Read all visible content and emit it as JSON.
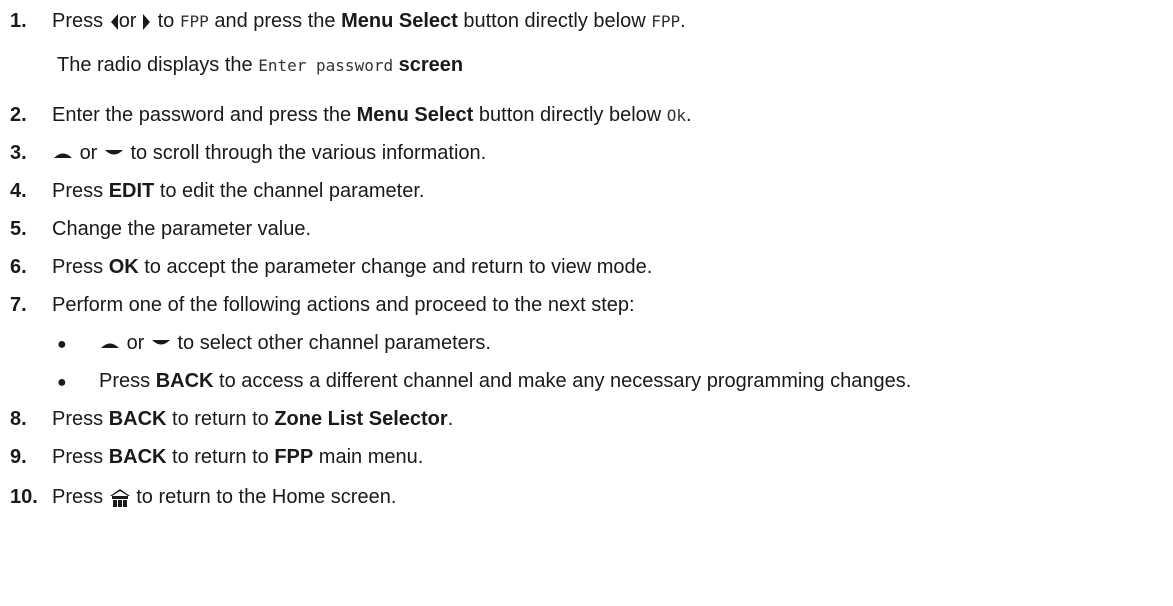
{
  "steps": [
    {
      "number": "1.",
      "parts": {
        "a": "Press",
        "or": "or",
        "b": "to",
        "fpp1": "FPP",
        "c": "and press the",
        "bold": "Menu Select",
        "d": "button directly below",
        "fpp2": "FPP",
        "e": "."
      },
      "sub": {
        "a": "The radio displays the",
        "mono": "Enter password",
        "b": "screen"
      },
      "icons": [
        "arrow-left-icon",
        "arrow-right-icon"
      ]
    },
    {
      "number": "2.",
      "parts": {
        "a": "Enter the password and press the",
        "bold": "Menu Select",
        "b": "button directly below",
        "mono": "Ok",
        "c": "."
      }
    },
    {
      "number": "3.",
      "parts": {
        "or": "or",
        "a": "to scroll through the various information."
      },
      "icons": [
        "arrow-up-icon",
        "arrow-down-icon"
      ]
    },
    {
      "number": "4.",
      "parts": {
        "a": "Press",
        "bold": "EDIT",
        "b": "to edit the channel parameter."
      }
    },
    {
      "number": "5.",
      "parts": {
        "a": "Change the parameter value."
      }
    },
    {
      "number": "6.",
      "parts": {
        "a": "Press",
        "bold": "OK",
        "b": "to accept the parameter change and return to view mode."
      }
    },
    {
      "number": "7.",
      "parts": {
        "a": "Perform one of the following actions and proceed to the next step:"
      },
      "bullets": [
        {
          "or": "or",
          "a": "to select other channel parameters."
        },
        {
          "a": "Press",
          "bold": "BACK",
          "b": "to access a different channel and make any necessary programming changes."
        }
      ]
    },
    {
      "number": "8.",
      "parts": {
        "a": "Press",
        "bold1": "BACK",
        "b": "to return to",
        "bold2": "Zone List Selector",
        "c": "."
      }
    },
    {
      "number": "9.",
      "parts": {
        "a": "Press",
        "bold1": "BACK",
        "b": "to return to",
        "bold2": "FPP",
        "c": "main menu."
      }
    },
    {
      "number": "10.",
      "parts": {
        "a": "Press",
        "b": "to return to the Home screen."
      },
      "icons": [
        "home-icon"
      ]
    }
  ],
  "colors": {
    "text": "#1a1a1a",
    "mono": "#333333"
  }
}
